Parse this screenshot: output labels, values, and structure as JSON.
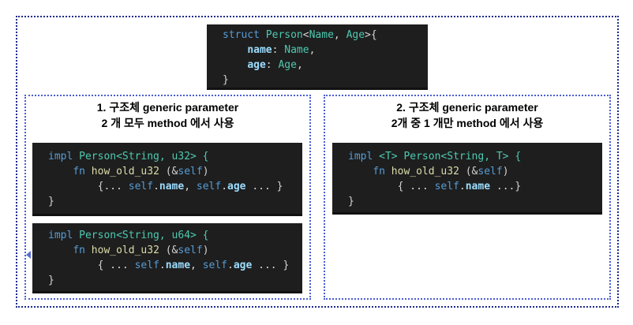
{
  "struct_def": {
    "line1": {
      "kw": "struct",
      "name": "Person",
      "lt": "<",
      "g1": "Name",
      "comma": ", ",
      "g2": "Age",
      "rest": ">{"
    },
    "line2": {
      "field": "name",
      "colon": ": ",
      "type": "Name",
      "end": ","
    },
    "line3": {
      "field": "age",
      "colon": ": ",
      "type": "Age",
      "end": ","
    },
    "line4": "}"
  },
  "panel1": {
    "title": "1. 구조체 generic parameter",
    "subtitle": "2 개 모두 method 에서 사용",
    "impl_a": {
      "kw": "impl",
      "head": "Person<String, u32> {",
      "fn_kw": "fn",
      "fn_name": "how_old_u32",
      "args": " (&",
      "self_kw": "self",
      "args_end": ")",
      "body_open": "{... ",
      "self1": "self",
      "dot1": ".",
      "field1": "name",
      "sep": ", ",
      "self2": "self",
      "dot2": ".",
      "field2": "age",
      "body_close": " ... }",
      "close": "}"
    },
    "impl_b": {
      "kw": "impl",
      "head": "Person<String, u64> {",
      "fn_kw": "fn",
      "fn_name": "how_old_u32",
      "args": " (&",
      "self_kw": "self",
      "args_end": ")",
      "body_open": "{ ... ",
      "self1": "self",
      "dot1": ".",
      "field1": "name",
      "sep": ", ",
      "self2": "self",
      "dot2": ".",
      "field2": "age",
      "body_close": " ... }",
      "close": "}"
    }
  },
  "panel2": {
    "title": "2. 구조체 generic parameter",
    "subtitle": "2개 중 1 개만 method 에서 사용",
    "impl_c": {
      "kw": "impl",
      "gen": " <T> ",
      "head": "Person<String, T> {",
      "fn_kw": "fn",
      "fn_name": "how_old_u32",
      "args": " (&",
      "self_kw": "self",
      "args_end": ")",
      "body_open": "{ ... ",
      "self1": "self",
      "dot1": ".",
      "field1": "name",
      "body_close": " ...}",
      "close": "}"
    }
  },
  "colors": {
    "keyword": "#569cd6",
    "type": "#4ec9b0",
    "function": "#dcdcaa",
    "field": "#9cdcfe",
    "code_bg": "#1e1e1e",
    "border": "#1c2a8a"
  }
}
